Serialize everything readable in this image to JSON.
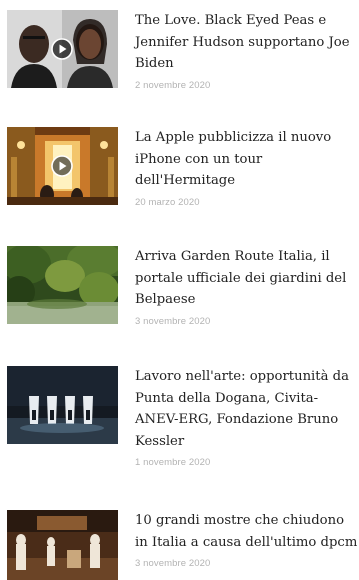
{
  "articles": [
    {
      "title_lines": [
        "The Love. Black Eyed Peas e",
        "Jennifer Hudson supportano Joe",
        "Biden"
      ],
      "date": "2 novembre 2020",
      "has_video": true,
      "thumb_icon": "video-thumbnail"
    },
    {
      "title_lines": [
        "La Apple pubblicizza il nuovo",
        "iPhone con un tour",
        "dell'Hermitage"
      ],
      "date": "20 marzo 2020",
      "has_video": true,
      "thumb_icon": "video-thumbnail"
    },
    {
      "title_lines": [
        "Arriva Garden Route Italia, il",
        "portale ufficiale dei giardini del",
        "Belpaese"
      ],
      "date": "3 novembre 2020",
      "has_video": false,
      "thumb_icon": "garden-photo"
    },
    {
      "title_lines": [
        "Lavoro nell'arte: opportunità da",
        "Punta della Dogana, Civita-",
        "ANEV-ERG, Fondazione Bruno",
        "Kessler"
      ],
      "date": "1 novembre 2020",
      "has_video": false,
      "thumb_icon": "exhibition-photo"
    },
    {
      "title_lines": [
        "10 grandi mostre che chiudono",
        "in Italia a causa dell'ultimo dpcm"
      ],
      "date": "3 novembre 2020",
      "has_video": false,
      "thumb_icon": "museum-photo"
    }
  ]
}
